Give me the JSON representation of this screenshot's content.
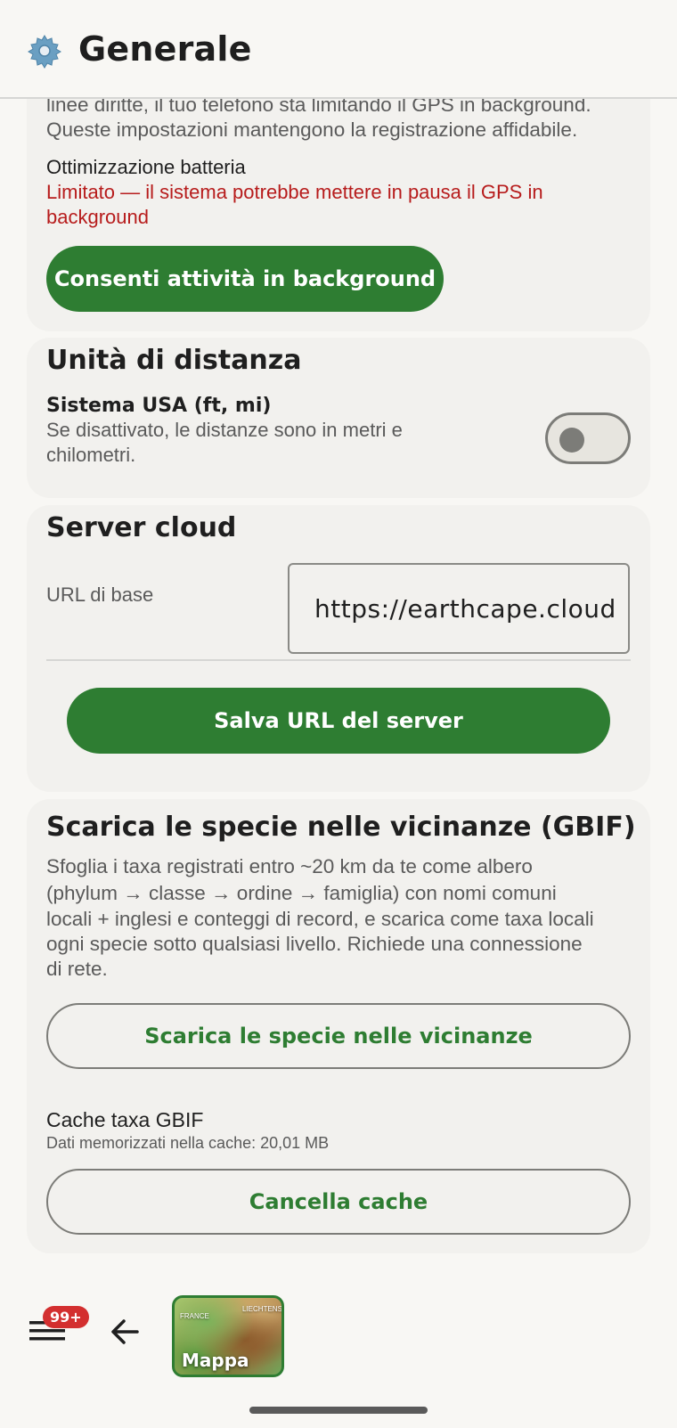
{
  "header": {
    "title": "Generale",
    "icon": "gear-icon"
  },
  "background_section": {
    "intro_line_1": "linee diritte, il tuo telefono sta limitando il GPS in background.",
    "intro_line_2": "Queste impostazioni mantengono la registrazione affidabile.",
    "battery_label": "Ottimizzazione batteria",
    "battery_status_line_1": "Limitato — il sistema potrebbe mettere in pausa il GPS in",
    "battery_status_line_2": "background",
    "allow_button": "Consenti attività in background"
  },
  "distance_units": {
    "title": "Unità di distanza",
    "toggle_label": "Sistema USA (ft, mi)",
    "toggle_desc_line_1": "Se disattivato, le distanze sono in metri e",
    "toggle_desc_line_2": "chilometri.",
    "toggle_on": false
  },
  "cloud_server": {
    "title": "Server cloud",
    "url_label": "URL di base",
    "url_value": "https://earthcape.cloud",
    "save_button": "Salva URL del server"
  },
  "gbif": {
    "title": "Scarica le specie nelle vicinanze (GBIF)",
    "desc_line_1": "Sfoglia i taxa registrati entro ~20 km da te come albero",
    "desc_line_2": "(phylum → classe → ordine → famiglia) con nomi comuni",
    "desc_line_3": "locali + inglesi e conteggi di record, e scarica come taxa locali",
    "desc_line_4": "ogni specie sotto qualsiasi livello. Richiede una connessione",
    "desc_line_5": "di rete.",
    "download_button": "Scarica le specie nelle vicinanze",
    "cache_title": "Cache taxa GBIF",
    "cache_info": "Dati memorizzati nella cache: 20,01 MB",
    "clear_button": "Cancella cache"
  },
  "bottom_nav": {
    "menu_badge": "99+",
    "map_label": "Mappa",
    "map_tiny_1": "FRANCE",
    "map_tiny_2": "LIECHTENS"
  },
  "colors": {
    "accent": "#2e7d32",
    "error": "#b71c1c",
    "badge": "#d32f2f"
  }
}
